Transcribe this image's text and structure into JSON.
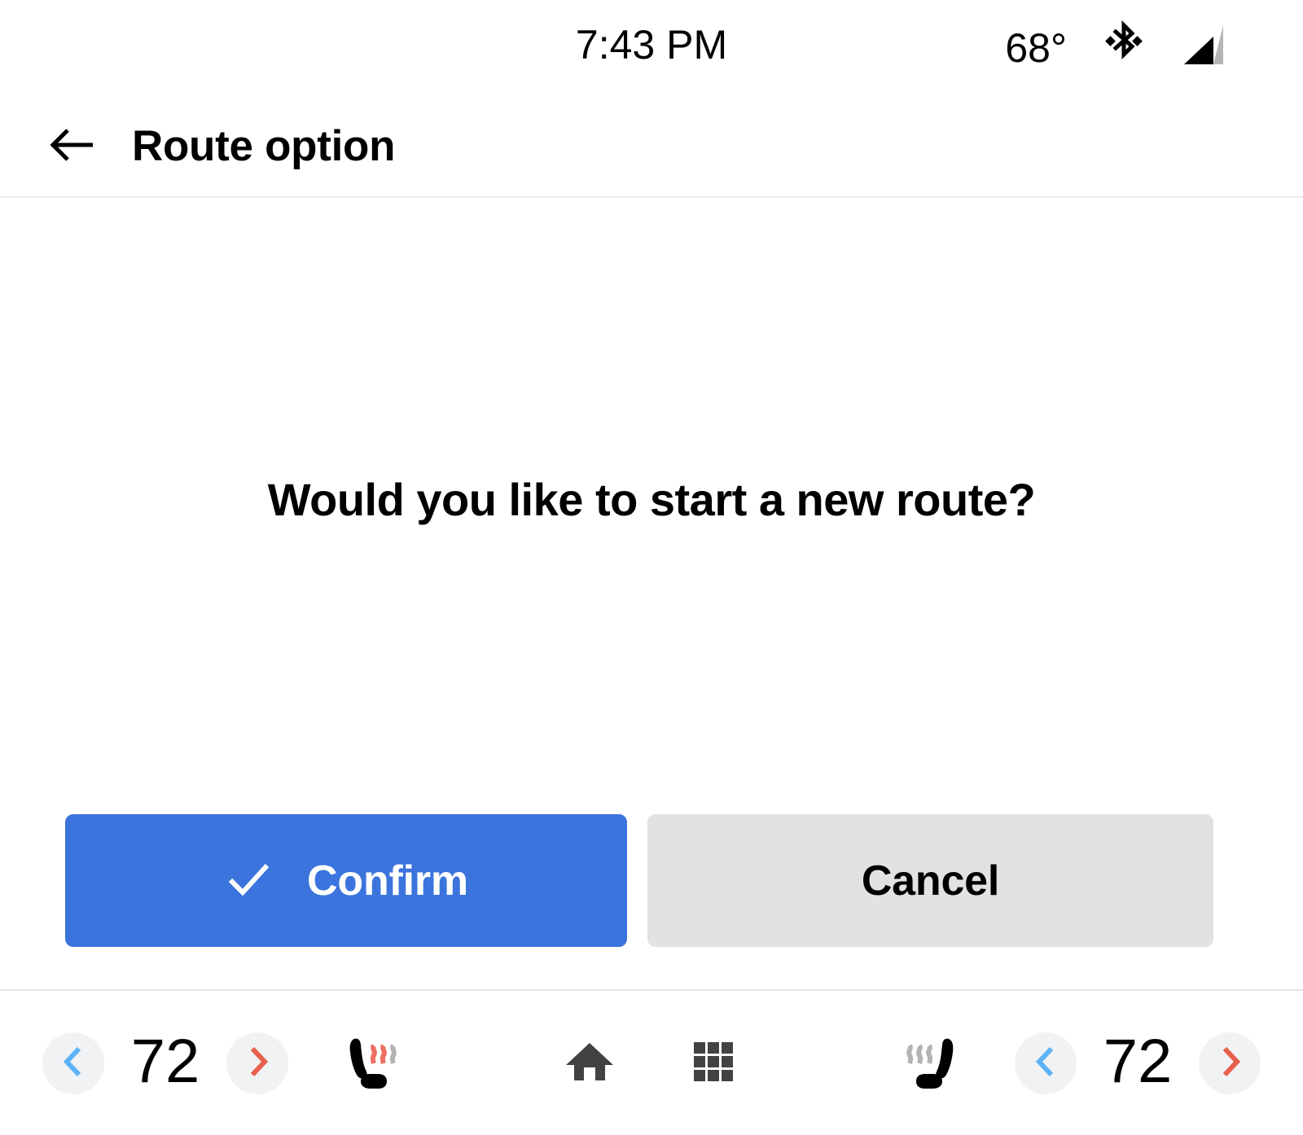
{
  "status_bar": {
    "time": "7:43 PM",
    "temperature": "68°",
    "bluetooth_icon": "bluetooth-icon",
    "signal_icon": "signal-bars-icon"
  },
  "header": {
    "back_icon": "arrow-left-icon",
    "title": "Route option"
  },
  "main": {
    "prompt": "Would you like to start a new route?",
    "confirm_button": {
      "label": "Confirm",
      "icon": "check-icon",
      "color": "#3B74DD",
      "text_color": "#FFFFFF"
    },
    "cancel_button": {
      "label": "Cancel",
      "color": "#E2E2E2",
      "text_color": "#000000"
    }
  },
  "climate_bar": {
    "left_zone": {
      "decrease_icon": "chevron-left-icon",
      "temperature": "72",
      "increase_icon": "chevron-right-icon",
      "seat_icon": "heated-seat-icon",
      "seat_heat_level": 2
    },
    "right_zone": {
      "seat_icon": "heated-seat-icon",
      "seat_heat_level": 0,
      "decrease_icon": "chevron-left-icon",
      "temperature": "72",
      "increase_icon": "chevron-right-icon"
    },
    "center": {
      "home_icon": "home-icon",
      "apps_icon": "apps-grid-icon"
    },
    "colors": {
      "decrease_accent": "#5CB3F7",
      "increase_accent": "#E8604C",
      "button_background": "#F1F2F4",
      "heat_active": "#EE6F62",
      "heat_inactive": "#B3B3B3",
      "center_icon": "#424242"
    }
  }
}
